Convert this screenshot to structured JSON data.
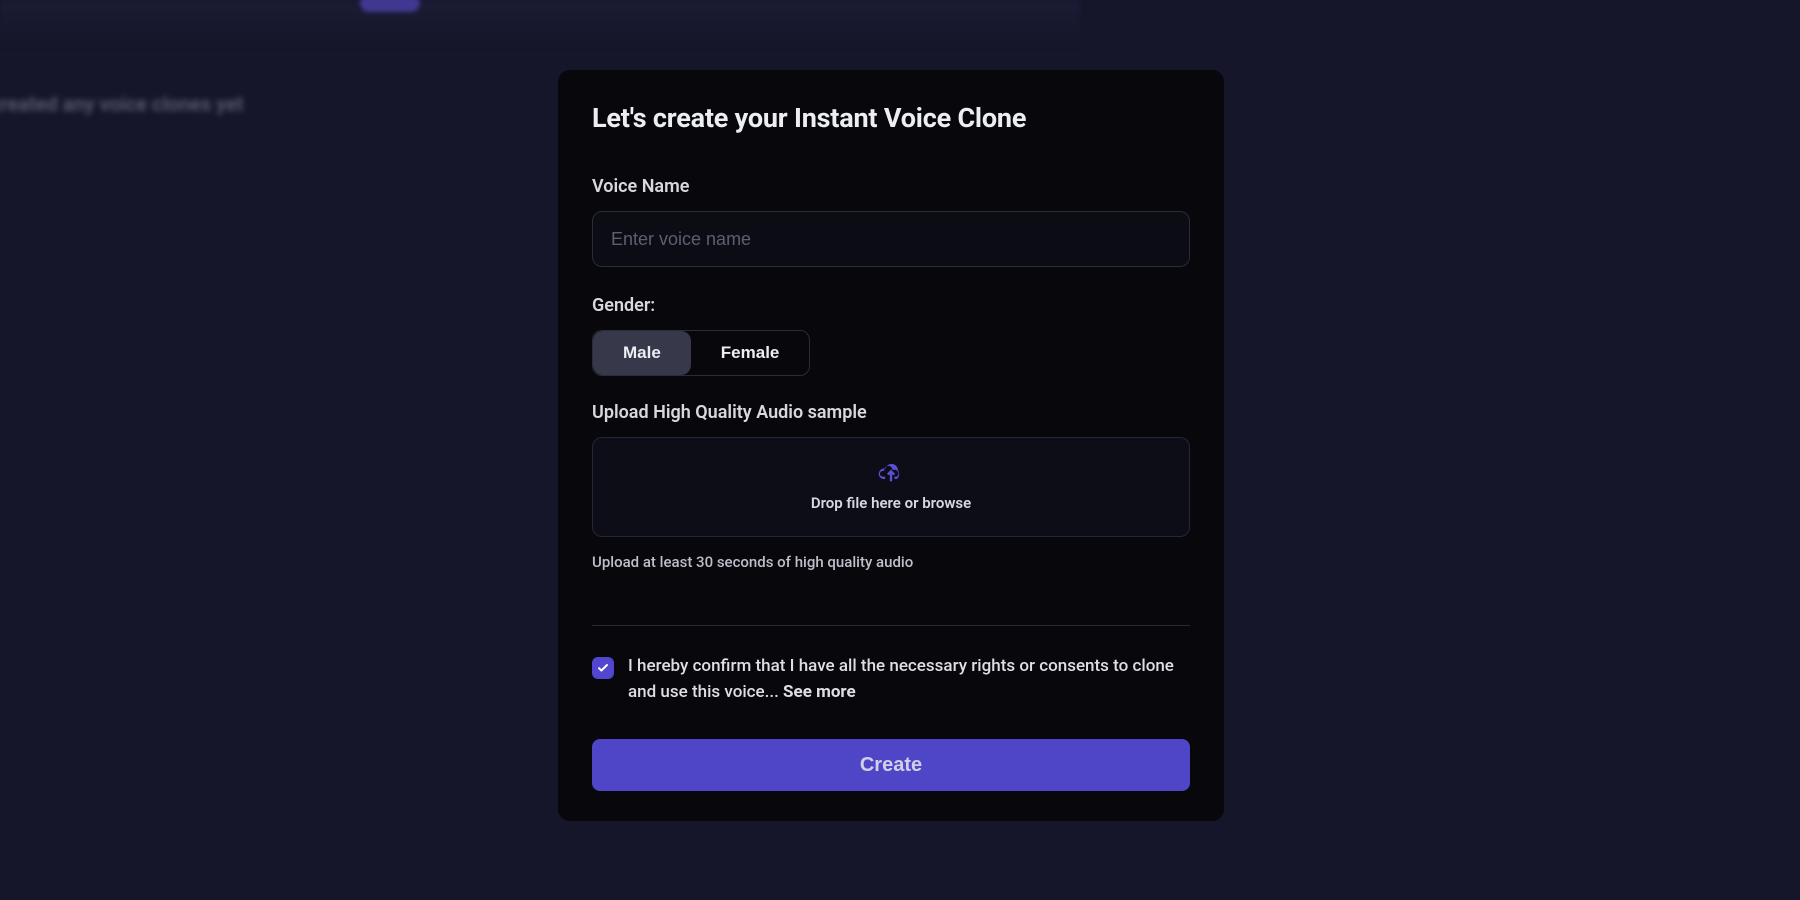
{
  "background": {
    "hint_text": "created any voice clones yet"
  },
  "modal": {
    "title": "Let's create your Instant Voice Clone",
    "voice_name": {
      "label": "Voice Name",
      "placeholder": "Enter voice name",
      "value": ""
    },
    "gender": {
      "label": "Gender:",
      "options": [
        "Male",
        "Female"
      ],
      "selected": "Male"
    },
    "upload": {
      "label": "Upload High Quality Audio sample",
      "dropzone_text": "Drop file here or browse",
      "hint": "Upload at least 30 seconds of high quality audio"
    },
    "consent": {
      "text": "I hereby confirm that I have all the necessary rights or consents to clone and use this voice... ",
      "see_more": "See more",
      "checked": true
    },
    "create_label": "Create"
  },
  "colors": {
    "accent": "#5246cf",
    "modal_bg": "#07070c",
    "page_bg": "#15162a"
  }
}
